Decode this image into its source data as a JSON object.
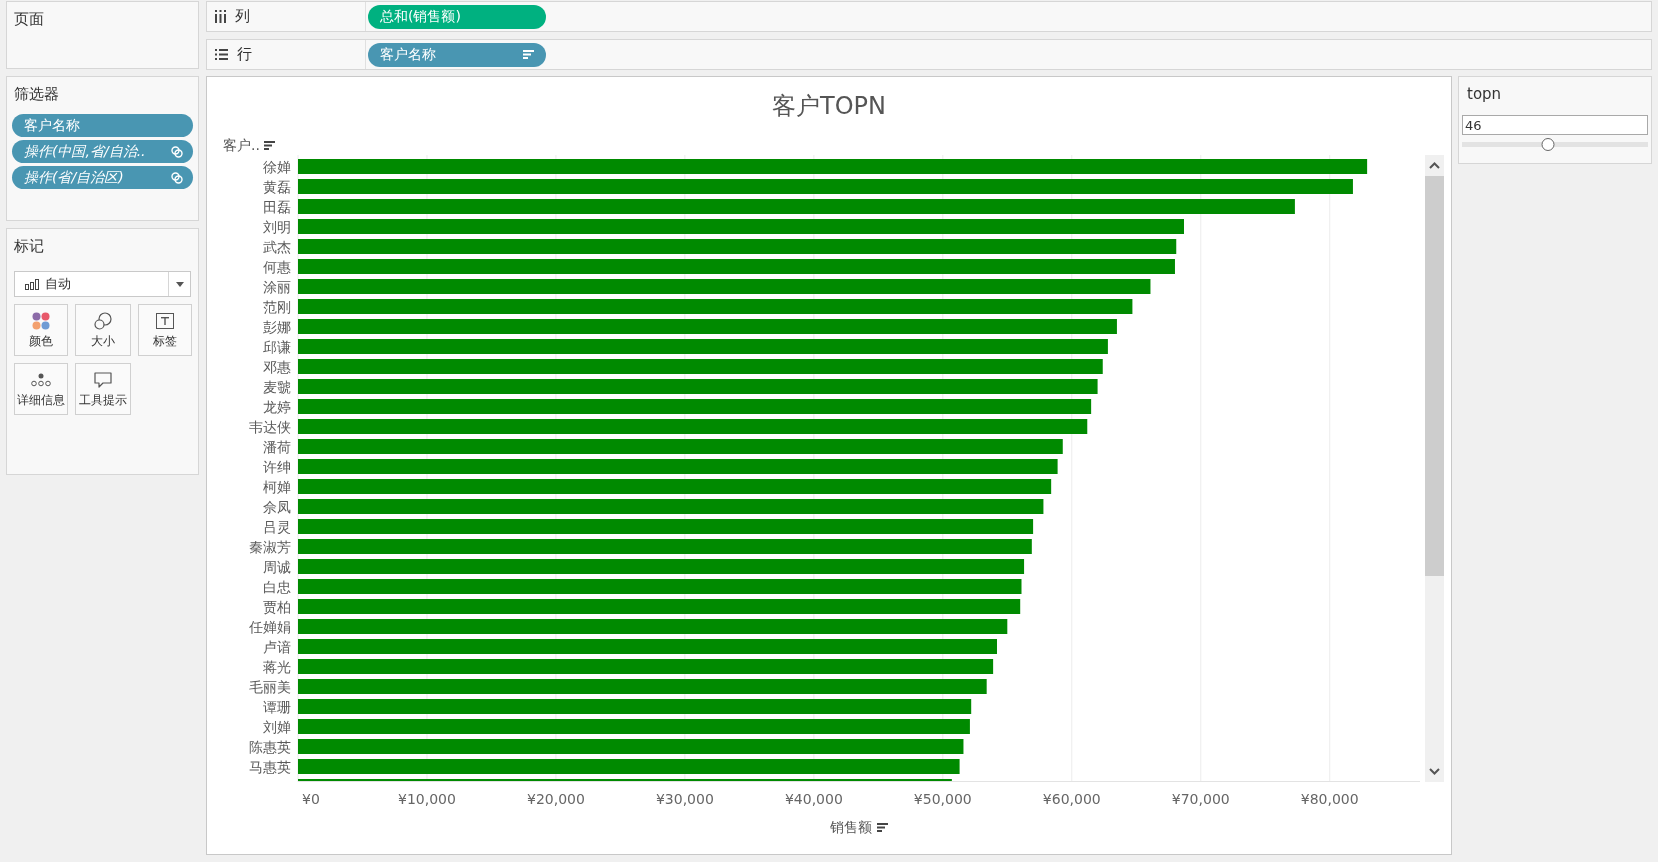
{
  "pages_card": {
    "title": "页面"
  },
  "shelves": [
    {
      "kind": "columns",
      "label": "列",
      "pills": [
        {
          "kind": "measure",
          "text": "总和(销售额)",
          "sorted": false
        }
      ]
    },
    {
      "kind": "rows",
      "label": "行",
      "pills": [
        {
          "kind": "dimension",
          "text": "客户名称",
          "sorted": true
        }
      ]
    }
  ],
  "filters_card": {
    "title": "筛选器",
    "pills": [
      {
        "kind": "field",
        "text": "客户名称"
      },
      {
        "kind": "action",
        "text": "操作(中国,省/自治.."
      },
      {
        "kind": "action",
        "text": "操作(省/自治区)"
      }
    ]
  },
  "marks_card": {
    "title": "标记",
    "mark_type": "自动",
    "buttons": [
      {
        "kind": "color",
        "label": "颜色"
      },
      {
        "kind": "size",
        "label": "大小"
      },
      {
        "kind": "label",
        "label": "标签"
      },
      {
        "kind": "detail",
        "label": "详细信息"
      },
      {
        "kind": "tooltip",
        "label": "工具提示"
      }
    ]
  },
  "view": {
    "chart_data": [
      {
        "type": "bar",
        "orientation": "horizontal",
        "title": "客户TOPN",
        "ylabel": "客户..",
        "xlabel": "销售额",
        "categories": [
          "徐婵",
          "黄磊",
          "田磊",
          "刘明",
          "武杰",
          "何惠",
          "涂丽",
          "范刚",
          "彭娜",
          "邱谦",
          "邓惠",
          "麦虢",
          "龙婷",
          "韦达侠",
          "潘荷",
          "许绅",
          "柯婵",
          "佘凤",
          "吕灵",
          "秦淑芳",
          "周诚",
          "白忠",
          "贾柏",
          "任婵娟",
          "卢谙",
          "蒋光",
          "毛丽美",
          "谭珊",
          "刘婵",
          "陈惠英",
          "马惠英",
          null
        ],
        "values": [
          82900,
          81800,
          77300,
          68700,
          68100,
          68000,
          66100,
          64700,
          63500,
          62800,
          62400,
          62000,
          61500,
          61200,
          59300,
          58900,
          58400,
          57800,
          57000,
          56900,
          56300,
          56100,
          56000,
          55000,
          54200,
          53900,
          53400,
          52200,
          52100,
          51600,
          51300,
          50700
        ],
        "color": "#008a00",
        "xlim": [
          0,
          87000
        ],
        "xticks": [
          {
            "value": 0,
            "label": "¥0"
          },
          {
            "value": 10000,
            "label": "¥10,000"
          },
          {
            "value": 20000,
            "label": "¥20,000"
          },
          {
            "value": 30000,
            "label": "¥30,000"
          },
          {
            "value": 40000,
            "label": "¥40,000"
          },
          {
            "value": 50000,
            "label": "¥50,000"
          },
          {
            "value": 60000,
            "label": "¥60,000"
          },
          {
            "value": 70000,
            "label": "¥70,000"
          },
          {
            "value": 80000,
            "label": "¥80,000"
          }
        ],
        "grid": true
      }
    ]
  },
  "parameter": {
    "title": "topn",
    "value": "46",
    "level": 0.46
  }
}
